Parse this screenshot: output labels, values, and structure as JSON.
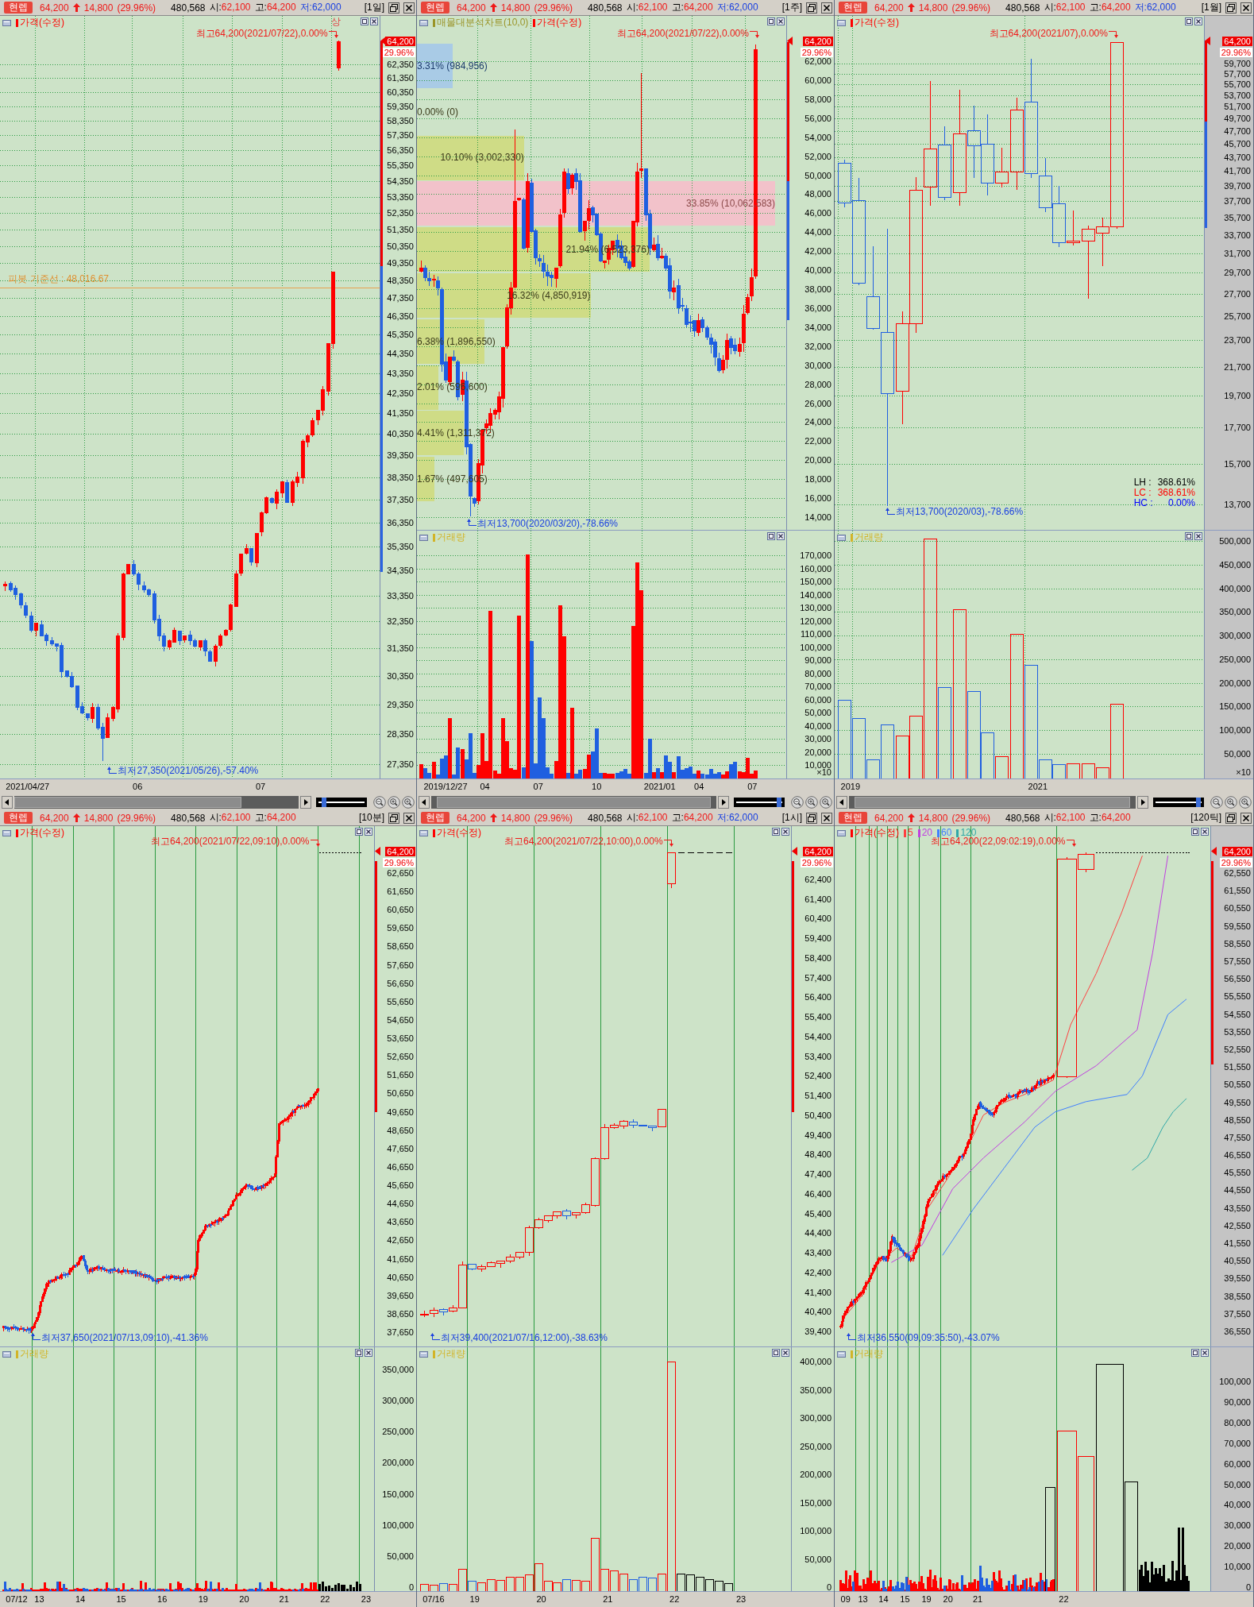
{
  "panels": [
    {
      "header": {
        "badge": "현렙",
        "price": "64,200",
        "change": "14,800",
        "rate": "(29.96%)",
        "volume": "480,568",
        "quotes": [
          {
            "label": "시:",
            "value": "62,100",
            "kind": "up"
          },
          {
            "label": "고:",
            "value": "64,200",
            "kind": "up"
          },
          {
            "label": "저:",
            "value": "62,000",
            "kind": "down"
          }
        ],
        "period": "[1일]"
      },
      "price_pane": {
        "legends": [
          {
            "label": "가격(수정)",
            "color": "#ff0000"
          }
        ],
        "high_note": "최고64,200(2021/07/22),0.00%",
        "limit_mark": "상",
        "pivot_label": "피봇 기준선 : 48,016.67",
        "low_note": "최저27,350(2021/05/26),-57.40%",
        "price_badge": "64,200",
        "rate_badge": "29.96%",
        "y_labels": [
          "62,350",
          "61,350",
          "60,350",
          "59,350",
          "58,350",
          "57,350",
          "56,350",
          "55,350",
          "54,350",
          "53,350",
          "52,350",
          "51,350",
          "50,350",
          "49,350",
          "48,350",
          "47,350",
          "46,350",
          "45,350",
          "44,350",
          "43,350",
          "42,350",
          "41,350",
          "40,350",
          "39,350",
          "38,350",
          "37,350",
          "36,350",
          "35,350",
          "34,350",
          "33,350",
          "32,350",
          "31,350",
          "30,350",
          "29,350",
          "28,350",
          "27,350"
        ]
      },
      "x_labels": [
        "2021/04/27",
        "06",
        "07"
      ],
      "zoom_slider": {
        "level": 0.12
      }
    },
    {
      "header": {
        "badge": "현렙",
        "price": "64,200",
        "change": "14,800",
        "rate": "(29.96%)",
        "volume": "480,568",
        "quotes": [
          {
            "label": "시:",
            "value": "62,100",
            "kind": "up"
          },
          {
            "label": "고:",
            "value": "64,200",
            "kind": "up"
          },
          {
            "label": "저:",
            "value": "62,000",
            "kind": "down"
          }
        ],
        "period": "[1주]"
      },
      "price_pane": {
        "legends": [
          {
            "label": "매물대분석차트(10,0)",
            "color": "#9a9428"
          },
          {
            "label": "가격(수정)",
            "color": "#ff0000"
          }
        ],
        "volume_profile_labels": [
          "3.31% (984,956)",
          "0.00% (0)",
          "10.10% (3,002,330)",
          "33.85% (10,062,583)",
          "21.94% (6,523,376)",
          "16.32% (4,850,919)",
          "6.38% (1,896,550)",
          "2.01% (596,600)",
          "4.41% (1,311,372)",
          "1.67% (497,605)"
        ],
        "high_note": "최고64,200(2021/07/22),0.00%",
        "low_note": "최저13,700(2020/03/20),-78.66%",
        "price_badge": "64,200",
        "rate_badge": "29.96%",
        "y_labels": [
          "62,000",
          "60,000",
          "58,000",
          "56,000",
          "54,000",
          "52,000",
          "50,000",
          "48,000",
          "46,000",
          "44,000",
          "42,000",
          "40,000",
          "38,000",
          "36,000",
          "34,000",
          "32,000",
          "30,000",
          "28,000",
          "26,000",
          "24,000",
          "22,000",
          "20,000",
          "18,000",
          "16,000",
          "14,000"
        ]
      },
      "volume_pane": {
        "legends": [
          {
            "label": "거래량",
            "color": "#d2b428"
          }
        ],
        "y_labels": [
          "170,000",
          "160,000",
          "150,000",
          "140,000",
          "130,000",
          "120,000",
          "110,000",
          "100,000",
          "90,000",
          "80,000",
          "70,000",
          "60,000",
          "50,000",
          "40,000",
          "30,000",
          "20,000",
          "10,000"
        ],
        "unit": "×10"
      },
      "x_labels": [
        "2019/12/27",
        "04",
        "07",
        "10",
        "2021/01",
        "04",
        "07"
      ],
      "zoom_slider": {
        "level": 0.93
      }
    },
    {
      "header": {
        "badge": "현렙",
        "price": "64,200",
        "change": "14,800",
        "rate": "(29.96%)",
        "volume": "480,568",
        "quotes": [
          {
            "label": "시:",
            "value": "62,100",
            "kind": "up"
          },
          {
            "label": "고:",
            "value": "64,200",
            "kind": "up"
          },
          {
            "label": "저:",
            "value": "62,000",
            "kind": "down"
          }
        ],
        "period": "[1월]"
      },
      "price_pane": {
        "legends": [
          {
            "label": "가격(수정)",
            "color": "#ff0000"
          }
        ],
        "high_note": "최고64,200(2021/07),0.00%",
        "low_note": "최저13,700(2020/03),-78.66%",
        "ratios": [
          {
            "label": "LH :",
            "value": "368.61%",
            "color": "#000000"
          },
          {
            "label": "LC :",
            "value": "368.61%",
            "color": "#ff0000"
          },
          {
            "label": "HC :",
            "value": "0.00%",
            "color": "#0000ff"
          }
        ],
        "price_badge": "64,200",
        "rate_badge": "29.96%",
        "y_labels": [
          "59,700",
          "57,700",
          "55,700",
          "53,700",
          "51,700",
          "49,700",
          "47,700",
          "45,700",
          "43,700",
          "41,700",
          "39,700",
          "37,700",
          "35,700",
          "33,700",
          "31,700",
          "29,700",
          "27,700",
          "25,700",
          "23,700",
          "21,700",
          "19,700",
          "17,700",
          "15,700",
          "13,700"
        ]
      },
      "volume_pane": {
        "legends": [
          {
            "label": "거래량",
            "color": "#d2b428"
          }
        ],
        "y_labels": [
          "500,000",
          "450,000",
          "400,000",
          "350,000",
          "300,000",
          "250,000",
          "200,000",
          "150,000",
          "100,000",
          "50,000"
        ],
        "unit": "×10"
      },
      "x_labels": [
        "2019",
        "2021"
      ],
      "zoom_slider": {
        "level": 0.93
      }
    },
    {
      "header": {
        "badge": "현렙",
        "price": "64,200",
        "change": "14,800",
        "rate": "(29.96%)",
        "volume": "480,568",
        "quotes": [
          {
            "label": "시:",
            "value": "62,100",
            "kind": "up"
          },
          {
            "label": "고:",
            "value": "64,200",
            "kind": "up"
          }
        ],
        "period": "[10분]"
      },
      "price_pane": {
        "legends": [
          {
            "label": "가격(수정)",
            "color": "#ff0000"
          }
        ],
        "high_note": "최고64,200(2021/07/22,09:10),0.00%",
        "low_note": "최저37,650(2021/07/13,09:10),-41.36%",
        "price_badge": "64,200",
        "rate_badge": "29.96%",
        "y_labels": [
          "62,650",
          "61,650",
          "60,650",
          "59,650",
          "58,650",
          "57,650",
          "56,650",
          "55,650",
          "54,650",
          "53,650",
          "52,650",
          "51,650",
          "50,650",
          "49,650",
          "48,650",
          "47,650",
          "46,650",
          "45,650",
          "44,650",
          "43,650",
          "42,650",
          "41,650",
          "40,650",
          "39,650",
          "38,650",
          "37,650"
        ]
      },
      "volume_pane": {
        "legends": [
          {
            "label": "거래량",
            "color": "#d2b428"
          }
        ],
        "y_labels": [
          "350,000",
          "300,000",
          "250,000",
          "200,000",
          "150,000",
          "100,000",
          "50,000",
          "0"
        ]
      },
      "x_labels": [
        "07/12",
        "13",
        "14",
        "15",
        "16",
        "19",
        "20",
        "21",
        "22",
        "23"
      ]
    },
    {
      "header": {
        "badge": "현렙",
        "price": "64,200",
        "change": "14,800",
        "rate": "(29.96%)",
        "volume": "480,568",
        "quotes": [
          {
            "label": "시:",
            "value": "62,100",
            "kind": "up"
          },
          {
            "label": "고:",
            "value": "64,200",
            "kind": "up"
          },
          {
            "label": "저:",
            "value": "62,000",
            "kind": "down"
          }
        ],
        "period": "[1시]"
      },
      "price_pane": {
        "legends": [
          {
            "label": "가격(수정)",
            "color": "#ff0000"
          }
        ],
        "high_note": "최고64,200(2021/07/22,10:00),0.00%",
        "low_note": "최저39,400(2021/07/16,12:00),-38.63%",
        "price_badge": "64,200",
        "rate_badge": "29.96%",
        "y_labels": [
          "62,400",
          "61,400",
          "60,400",
          "59,400",
          "58,400",
          "57,400",
          "56,400",
          "55,400",
          "54,400",
          "53,400",
          "52,400",
          "51,400",
          "50,400",
          "49,400",
          "48,400",
          "47,400",
          "46,400",
          "45,400",
          "44,400",
          "43,400",
          "42,400",
          "41,400",
          "40,400",
          "39,400"
        ]
      },
      "volume_pane": {
        "legends": [
          {
            "label": "거래량",
            "color": "#d2b428"
          }
        ],
        "y_labels": [
          "400,000",
          "350,000",
          "300,000",
          "250,000",
          "200,000",
          "150,000",
          "100,000",
          "50,000",
          "0"
        ]
      },
      "x_labels": [
        "07/16",
        "19",
        "20",
        "21",
        "22",
        "23"
      ]
    },
    {
      "header": {
        "badge": "현렙",
        "price": "64,200",
        "change": "14,800",
        "rate": "(29.96%)",
        "volume": "480,568",
        "quotes": [
          {
            "label": "시:",
            "value": "62,100",
            "kind": "up"
          },
          {
            "label": "고:",
            "value": "64,200",
            "kind": "up"
          }
        ],
        "period": "[120틱]"
      },
      "price_pane": {
        "legends": [
          {
            "label": "가격(수정)",
            "color": "#ff0000"
          },
          {
            "label": "5",
            "color": "#ff4040"
          },
          {
            "label": "20",
            "color": "#c040e0"
          },
          {
            "label": "60",
            "color": "#4080ff"
          },
          {
            "label": "120",
            "color": "#30a8a8"
          }
        ],
        "high_note": "최고64,200(22,09:02:19),0.00%",
        "low_note": "최저36,550(09,09:35:50),-43.07%",
        "price_badge": "64,200",
        "rate_badge": "29.96%",
        "y_labels": [
          "62,550",
          "61,550",
          "60,550",
          "59,550",
          "58,550",
          "57,550",
          "56,550",
          "55,550",
          "54,550",
          "53,550",
          "52,550",
          "51,550",
          "50,550",
          "49,550",
          "48,550",
          "47,550",
          "46,550",
          "45,550",
          "44,550",
          "43,550",
          "42,550",
          "41,550",
          "40,550",
          "39,550",
          "38,550",
          "37,550",
          "36,550"
        ]
      },
      "volume_pane": {
        "legends": [
          {
            "label": "거래량",
            "color": "#d2b428"
          }
        ],
        "y_labels": [
          "100,000",
          "90,000",
          "80,000",
          "70,000",
          "60,000",
          "50,000",
          "40,000",
          "30,000",
          "20,000",
          "10,000",
          "0"
        ]
      },
      "x_labels": [
        "09",
        "13",
        "14",
        "15",
        "19",
        "20",
        "21",
        "22"
      ]
    }
  ]
}
